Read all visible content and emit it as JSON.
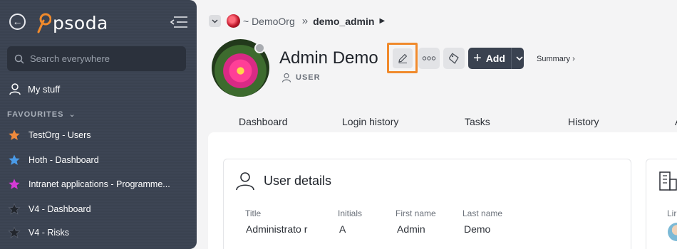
{
  "sidebar": {
    "logo_text": "psoda",
    "search": {
      "placeholder": "Search everywhere"
    },
    "my_stuff": "My stuff",
    "favourites_header": "FAVOURITES",
    "favourites": [
      {
        "label": "TestOrg - Users",
        "color": "#f08a3c"
      },
      {
        "label": "Hoth - Dashboard",
        "color": "#4a9be8"
      },
      {
        "label": "Intranet applications - Programme...",
        "color": "#d63ad6"
      },
      {
        "label": "V4 - Dashboard",
        "color": "#2a2f38"
      },
      {
        "label": "V4 - Risks",
        "color": "#2a2f38"
      }
    ]
  },
  "breadcrumb": {
    "org": "~ DemoOrg",
    "separator": "»",
    "current": "demo_admin"
  },
  "profile": {
    "name": "Admin Demo",
    "role": "USER"
  },
  "toolbar": {
    "add_label": "Add",
    "summary_label": "Summary ›"
  },
  "tabs": [
    "Dashboard",
    "Login history",
    "Tasks",
    "History",
    "A"
  ],
  "user_details": {
    "title": "User details",
    "fields": [
      {
        "label": "Title",
        "value": "Administrato r"
      },
      {
        "label": "Initials",
        "value": "A"
      },
      {
        "label": "First name",
        "value": "Admin"
      },
      {
        "label": "Last name",
        "value": "Demo"
      }
    ]
  },
  "second_card": {
    "field_label": "Lir"
  },
  "colors": {
    "sidebar_bg": "#3b4351",
    "accent_orange": "#f08a2c",
    "add_button": "#3a4250"
  }
}
